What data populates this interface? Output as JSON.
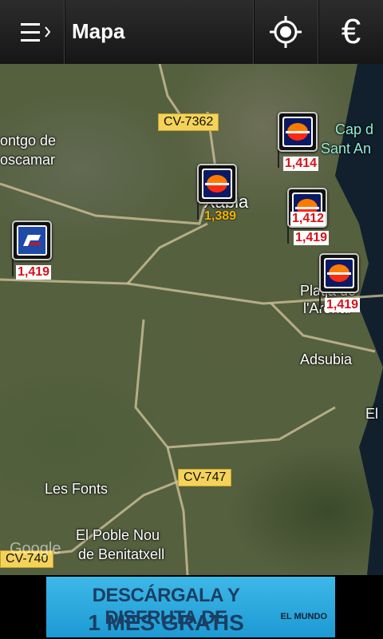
{
  "header": {
    "title": "Mapa",
    "menu_icon": "menu-drawer-icon",
    "location_icon": "gps-target-icon",
    "euro_icon": "euro-icon",
    "euro_glyph": "€"
  },
  "map": {
    "places": [
      {
        "text": "ontgo de",
        "cyan": false
      },
      {
        "text": "oscamar",
        "cyan": false
      },
      {
        "text": "Cap d",
        "cyan": true
      },
      {
        "text": "Sant An",
        "cyan": true
      },
      {
        "text": "Xàbia",
        "cyan": false
      },
      {
        "text": "Platja de",
        "cyan": false
      },
      {
        "text": "l'Arenal",
        "cyan": false
      },
      {
        "text": "Adsubia",
        "cyan": false
      },
      {
        "text": "El",
        "cyan": false
      },
      {
        "text": "Les Fonts",
        "cyan": false
      },
      {
        "text": "El Poble Nou",
        "cyan": false
      },
      {
        "text": "de Benitatxell",
        "cyan": false
      }
    ],
    "roads": [
      "CV-7362",
      "CV-747",
      "CV-740"
    ],
    "google_logo": "Google",
    "stations": [
      {
        "brand": "repsol",
        "price": "1,414",
        "price_color": "#d8101a"
      },
      {
        "brand": "repsol",
        "price": "1,389",
        "price_color": "#f0b400"
      },
      {
        "brand": "repsol",
        "price": "1,412",
        "price_color": "#d8101a"
      },
      {
        "brand": "repsol",
        "price": "1,419",
        "price_color": "#d8101a"
      },
      {
        "brand": "petronor",
        "price": "1,419",
        "price_color": "#d8101a"
      },
      {
        "brand": "repsol",
        "price": "1,419",
        "price_color": "#d8101a"
      }
    ]
  },
  "ad": {
    "line1": "DESCÁRGALA Y DISFRUTA DE",
    "line2": "1 MES GRATIS",
    "logo": "EL MUNDO"
  }
}
